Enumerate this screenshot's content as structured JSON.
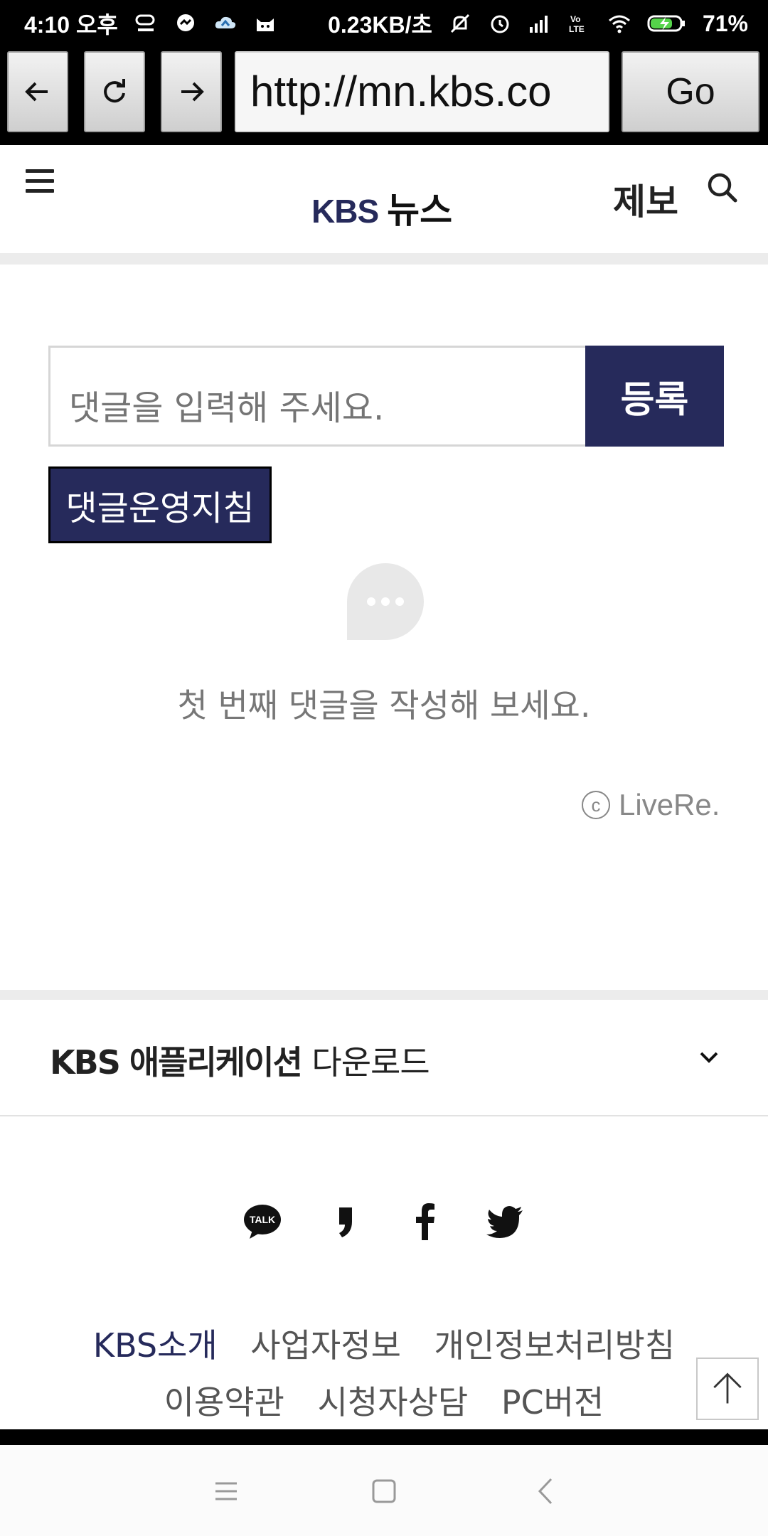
{
  "status_bar": {
    "time": "4:10 오후",
    "network_speed": "0.23KB/초",
    "battery": "71%",
    "left_icons": [
      "carrier-logo-icon",
      "messenger-icon",
      "cloud-icon",
      "cat-app-icon"
    ],
    "right_icons": [
      "mute-icon",
      "alarm-icon",
      "signal-icon",
      "volte-icon",
      "wifi-icon",
      "battery-charging-icon"
    ]
  },
  "browser": {
    "url": "http://mn.kbs.co",
    "go_label": "Go"
  },
  "header": {
    "logo_kbs": "KBS",
    "logo_news": "뉴스",
    "report_label": "제보"
  },
  "comments": {
    "input_placeholder": "댓글을 입력해 주세요.",
    "submit_label": "등록",
    "policy_label": "댓글운영지침",
    "empty_message": "첫 번째 댓글을 작성해 보세요.",
    "provider_label": "LiveRe.",
    "provider_mark": "c"
  },
  "app_download": {
    "title_bold": "KBS 애플리케이션",
    "title_light": "다운로드"
  },
  "social": [
    "kakaotalk-icon",
    "kakaostory-icon",
    "facebook-icon",
    "twitter-icon"
  ],
  "social_talk_text": "TALK",
  "footer": {
    "row1": [
      "KBS소개",
      "사업자정보",
      "개인정보처리방침"
    ],
    "row2": [
      "이용약관",
      "시청자상담",
      "PC버전"
    ]
  },
  "colors": {
    "brand_navy": "#262a5b",
    "text_gray": "#777777"
  }
}
